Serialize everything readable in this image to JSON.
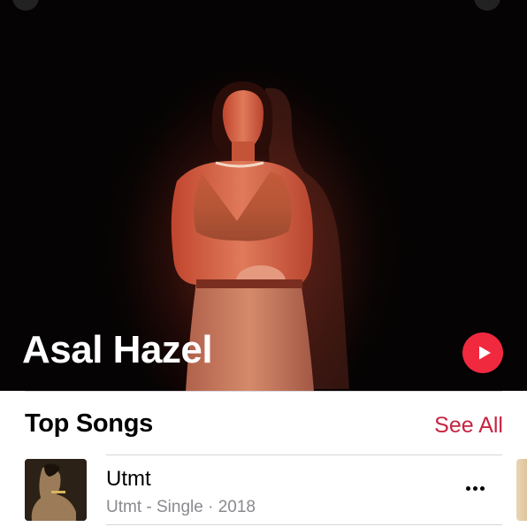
{
  "artist": {
    "name": "Asal Hazel",
    "hero_image": "artist-photo",
    "play_icon": "play-icon"
  },
  "top_songs": {
    "title": "Top Songs",
    "see_all_label": "See All",
    "items": [
      {
        "title": "Utmt",
        "subtitle": "Utmt - Single · 2018",
        "artwork": "album-artwork",
        "more_icon": "ellipsis-icon"
      }
    ]
  },
  "colors": {
    "accent": "#f0293f",
    "link": "#c72440",
    "secondary_text": "#8a8a8e"
  }
}
